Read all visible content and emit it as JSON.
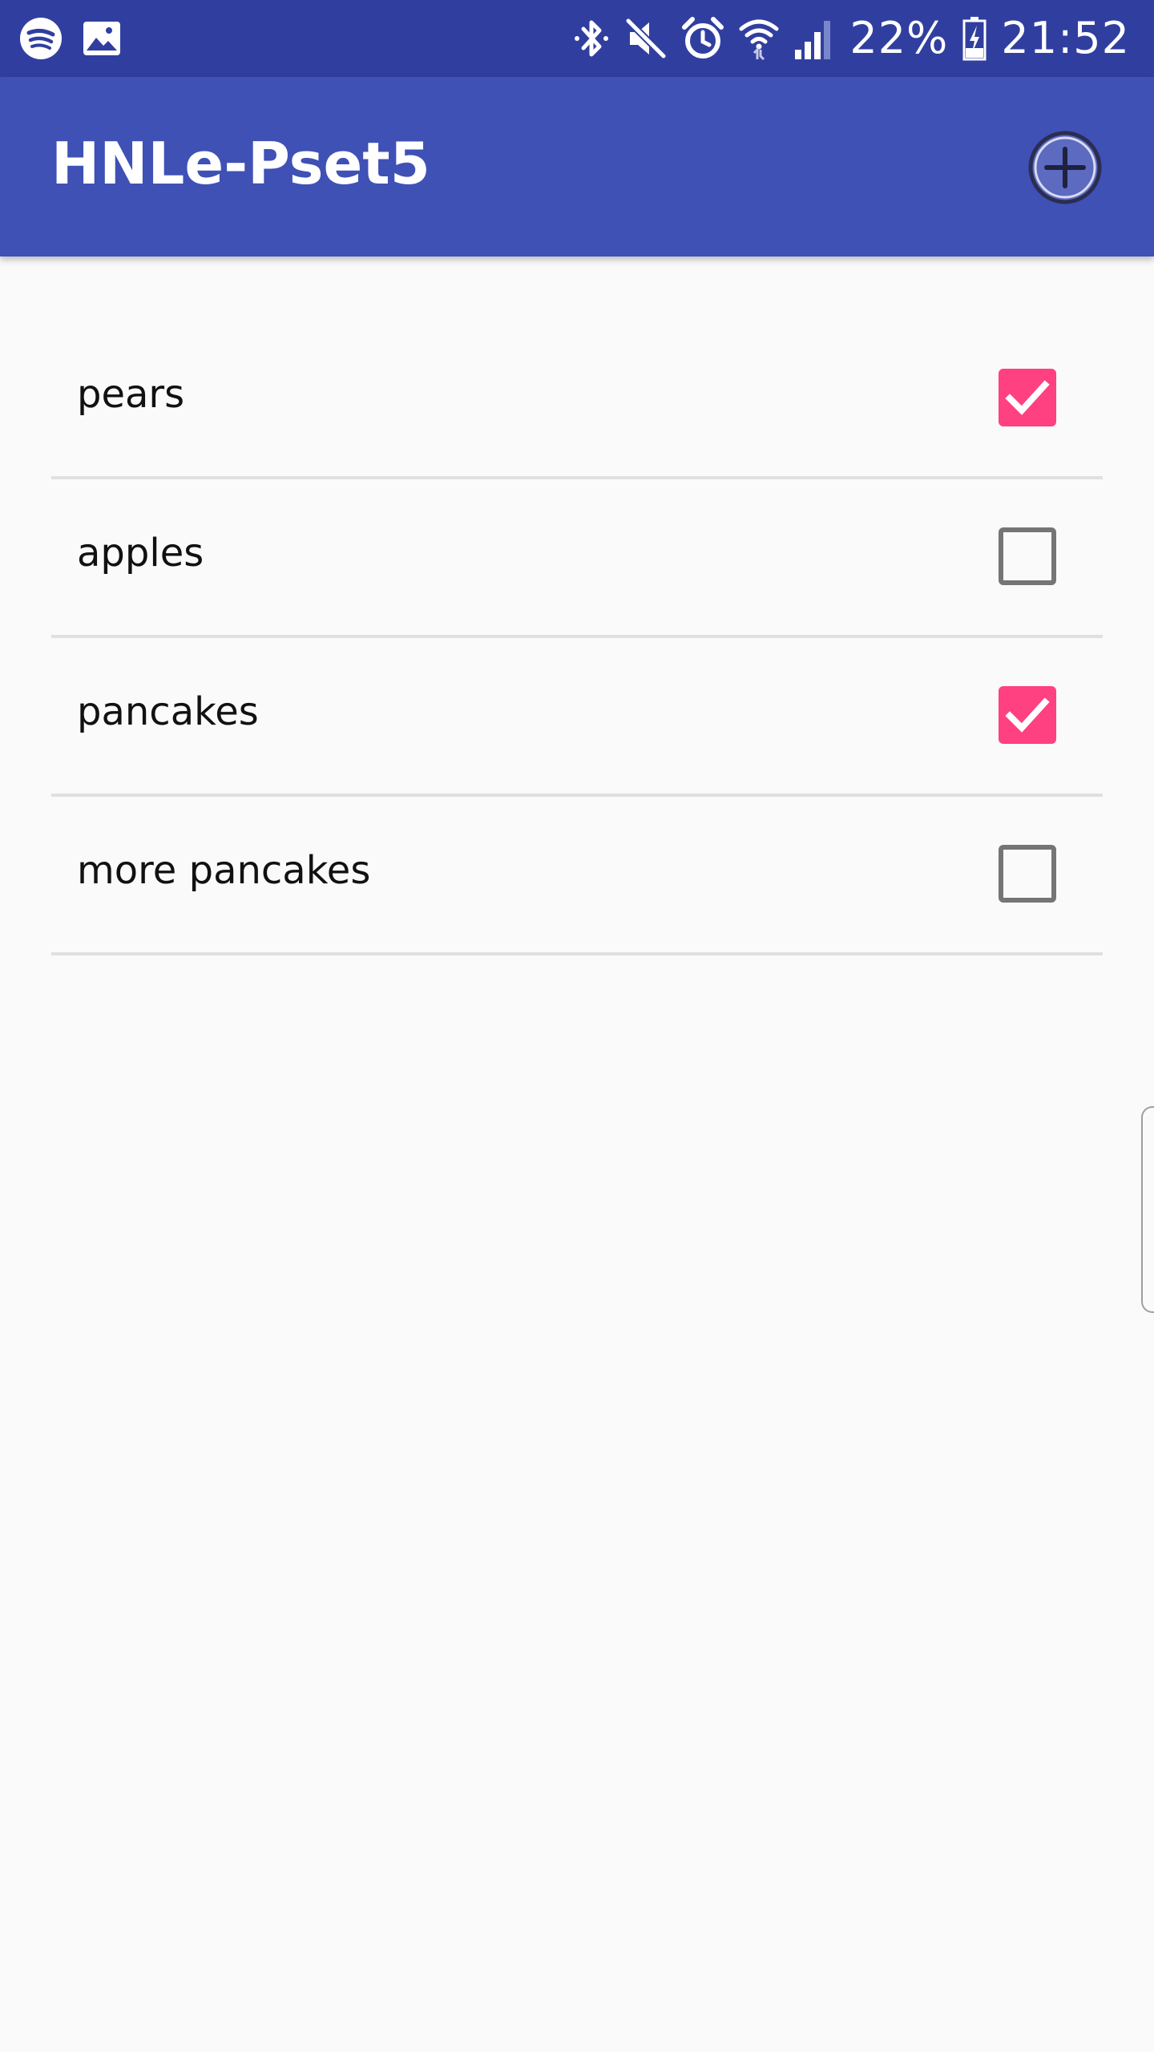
{
  "status_bar": {
    "left_icons": [
      "spotify-icon",
      "image-icon"
    ],
    "right_icons": [
      "bluetooth-icon",
      "mute-icon",
      "alarm-icon",
      "wifi-icon",
      "signal-icon"
    ],
    "battery_percent": "22%",
    "time": "21:52"
  },
  "app_bar": {
    "title": "HNLe-Pset5",
    "add_icon": "add-circle-icon",
    "color": "#3f51b5",
    "status_color": "#303f9f"
  },
  "todo_items": [
    {
      "label": "pears",
      "checked": true
    },
    {
      "label": "apples",
      "checked": false
    },
    {
      "label": "pancakes",
      "checked": true
    },
    {
      "label": "more pancakes",
      "checked": false
    }
  ],
  "colors": {
    "accent": "#ff4081",
    "background": "#fafafa",
    "divider": "#e0e0e0",
    "checkbox_off": "#757575"
  }
}
